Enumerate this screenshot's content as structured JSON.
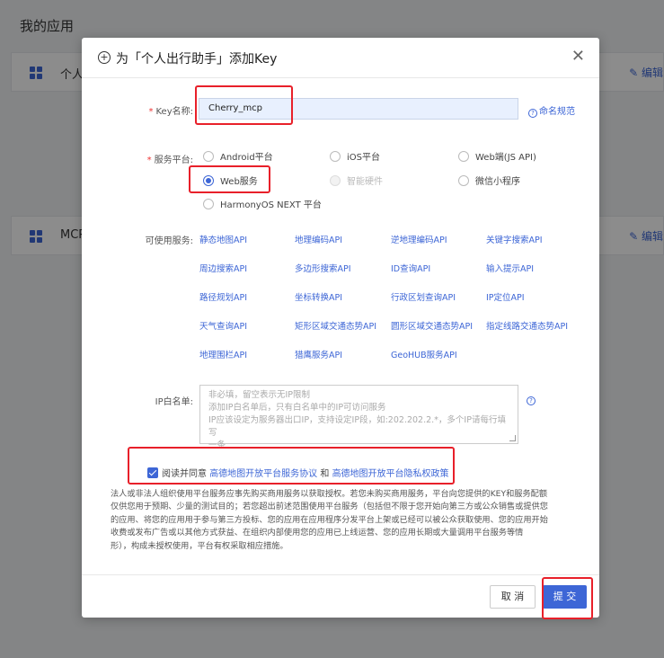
{
  "background": {
    "page_title": "我的应用",
    "cards": [
      {
        "name": "个人",
        "edit": "编辑"
      },
      {
        "name": "MCP",
        "edit": "编辑"
      }
    ]
  },
  "dialog": {
    "title": "为「个人出行助手」添加Key",
    "key_name_label": "Key名称:",
    "key_name_value": "Cherry_mcp",
    "naming_rules": "命名规范",
    "platform_label": "服务平台:",
    "platforms": [
      {
        "label": "Android平台",
        "checked": false,
        "disabled": false
      },
      {
        "label": "iOS平台",
        "checked": false,
        "disabled": false
      },
      {
        "label": "Web端(JS API)",
        "checked": false,
        "disabled": false
      },
      {
        "label": "Web服务",
        "checked": true,
        "disabled": false
      },
      {
        "label": "智能硬件",
        "checked": false,
        "disabled": true
      },
      {
        "label": "微信小程序",
        "checked": false,
        "disabled": false
      },
      {
        "label": "HarmonyOS NEXT 平台",
        "checked": false,
        "disabled": false
      }
    ],
    "available_label": "可使用服务:",
    "apis": [
      "静态地图API",
      "地理编码API",
      "逆地理编码API",
      "关键字搜索API",
      "周边搜索API",
      "多边形搜索API",
      "ID查询API",
      "输入提示API",
      "路径规划API",
      "坐标转换API",
      "行政区划查询API",
      "IP定位API",
      "天气查询API",
      "矩形区域交通态势API",
      "圆形区域交通态势API",
      "指定线路交通态势API",
      "地理围栏API",
      "猎鹰服务API",
      "GeoHUB服务API"
    ],
    "ip_label": "IP白名单:",
    "ip_placeholder_lines": [
      "非必填，留空表示无IP限制",
      "添加IP白名单后，只有白名单中的IP可访问服务",
      "IP应该设定为服务器出口IP，支持设定IP段，如:202.202.2.*，多个IP请每行填写",
      "一条"
    ],
    "agree_prefix": "阅读并同意",
    "agree_link1": "高德地图开放平台服务协议",
    "agree_and": "和",
    "agree_link2": "高德地图开放平台隐私权政策",
    "notice_lines": [
      "法人或非法人组织使用平台服务应事先购买商用服务以获取授权。若您未购买商用服务，平台向您提供的KEY和服务配额",
      "仅供您用于预期、少量的测试目的；若您超出前述范围使用平台服务（包括但不限于您开始向第三方或公众销售或提供您",
      "的应用、将您的应用用于参与第三方投标、您的应用在应用程序分发平台上架或已经可以被公众获取使用、您的应用开始",
      "收费或发布广告或以其他方式获益、在组织内部使用您的应用已上线运营、您的应用长期或大量调用平台服务等情",
      "形），构成未授权使用，平台有权采取相应措施。"
    ],
    "cancel": "取 消",
    "submit": "提 交"
  },
  "colors": {
    "accent": "#3d66d6",
    "highlight": "#e8202a",
    "required": "#e33333"
  }
}
